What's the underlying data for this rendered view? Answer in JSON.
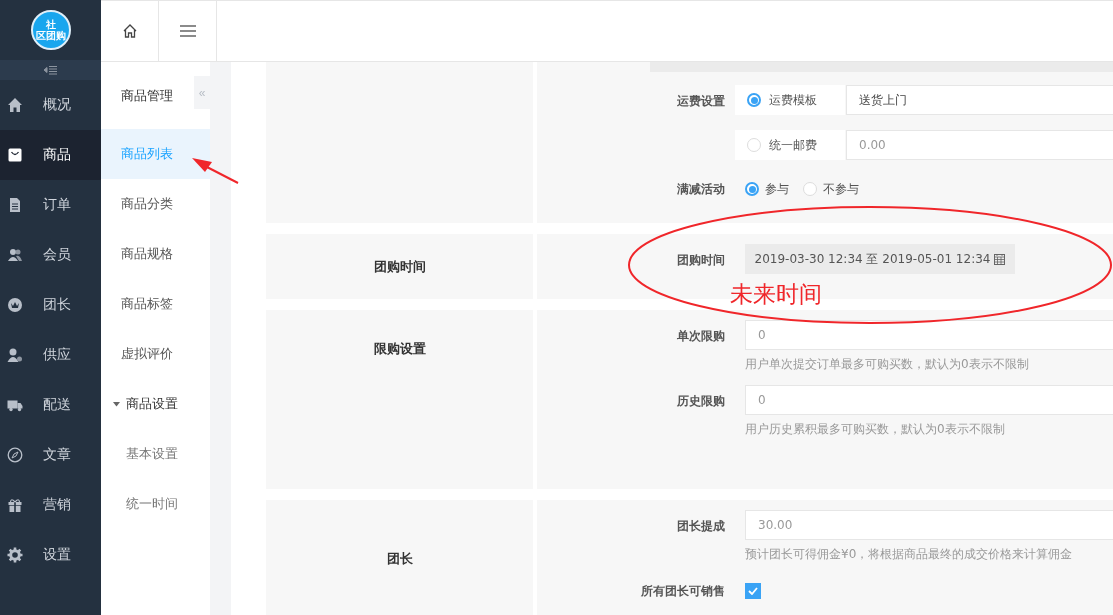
{
  "sidebar": {
    "logo_text": [
      "社",
      "区团购"
    ],
    "items": [
      {
        "label": "概况",
        "selected": false
      },
      {
        "label": "商品",
        "selected": true
      },
      {
        "label": "订单",
        "selected": false
      },
      {
        "label": "会员",
        "selected": false
      },
      {
        "label": "团长",
        "selected": false
      },
      {
        "label": "供应",
        "selected": false
      },
      {
        "label": "配送",
        "selected": false
      },
      {
        "label": "文章",
        "selected": false
      },
      {
        "label": "营销",
        "selected": false
      },
      {
        "label": "设置",
        "selected": false
      }
    ]
  },
  "subnav": {
    "title": "商品管理",
    "collapse_label": "«",
    "items": [
      {
        "label": "商品列表",
        "kind": "link",
        "selected": true
      },
      {
        "label": "商品分类",
        "kind": "link",
        "selected": false
      },
      {
        "label": "商品规格",
        "kind": "link",
        "selected": false
      },
      {
        "label": "商品标签",
        "kind": "link",
        "selected": false
      },
      {
        "label": "虚拟评价",
        "kind": "link",
        "selected": false
      },
      {
        "label": "商品设置",
        "kind": "group",
        "expanded": true,
        "children": [
          {
            "label": "基本设置",
            "selected": false
          },
          {
            "label": "统一时间",
            "selected": false
          }
        ]
      }
    ]
  },
  "form": {
    "sections": [
      {
        "rows": [
          {
            "kind": "radio_input",
            "label": "运费设置",
            "option": "运费模板",
            "selected": true,
            "value": "送货上门"
          },
          {
            "kind": "radio_input",
            "option": "统一邮费",
            "selected": false,
            "placeholder": "0.00"
          },
          {
            "kind": "radio_group",
            "label": "满减活动",
            "options": [
              {
                "label": "参与",
                "selected": true
              },
              {
                "label": "不参与",
                "selected": false
              }
            ]
          }
        ]
      },
      {
        "title": "团购时间",
        "rows": [
          {
            "kind": "date_range",
            "label": "团购时间",
            "value": "2019-03-30 12:34 至 2019-05-01 12:34"
          }
        ]
      },
      {
        "title": "限购设置",
        "rows": [
          {
            "kind": "input",
            "label": "单次限购",
            "placeholder": "0",
            "help": "用户单次提交订单最多可购买数，默认为0表示不限制"
          },
          {
            "kind": "input",
            "label": "历史限购",
            "placeholder": "0",
            "help": "用户历史累积最多可购买数，默认为0表示不限制"
          }
        ]
      },
      {
        "title": "团长",
        "rows": [
          {
            "kind": "input",
            "label": "团长提成",
            "placeholder": "30.00",
            "help": "预计团长可得佣金¥0，将根据商品最终的成交价格来计算佣金"
          },
          {
            "kind": "checkbox",
            "label": "所有团长可销售",
            "checked": true
          }
        ]
      }
    ]
  },
  "annotation": {
    "text": "未来时间"
  }
}
